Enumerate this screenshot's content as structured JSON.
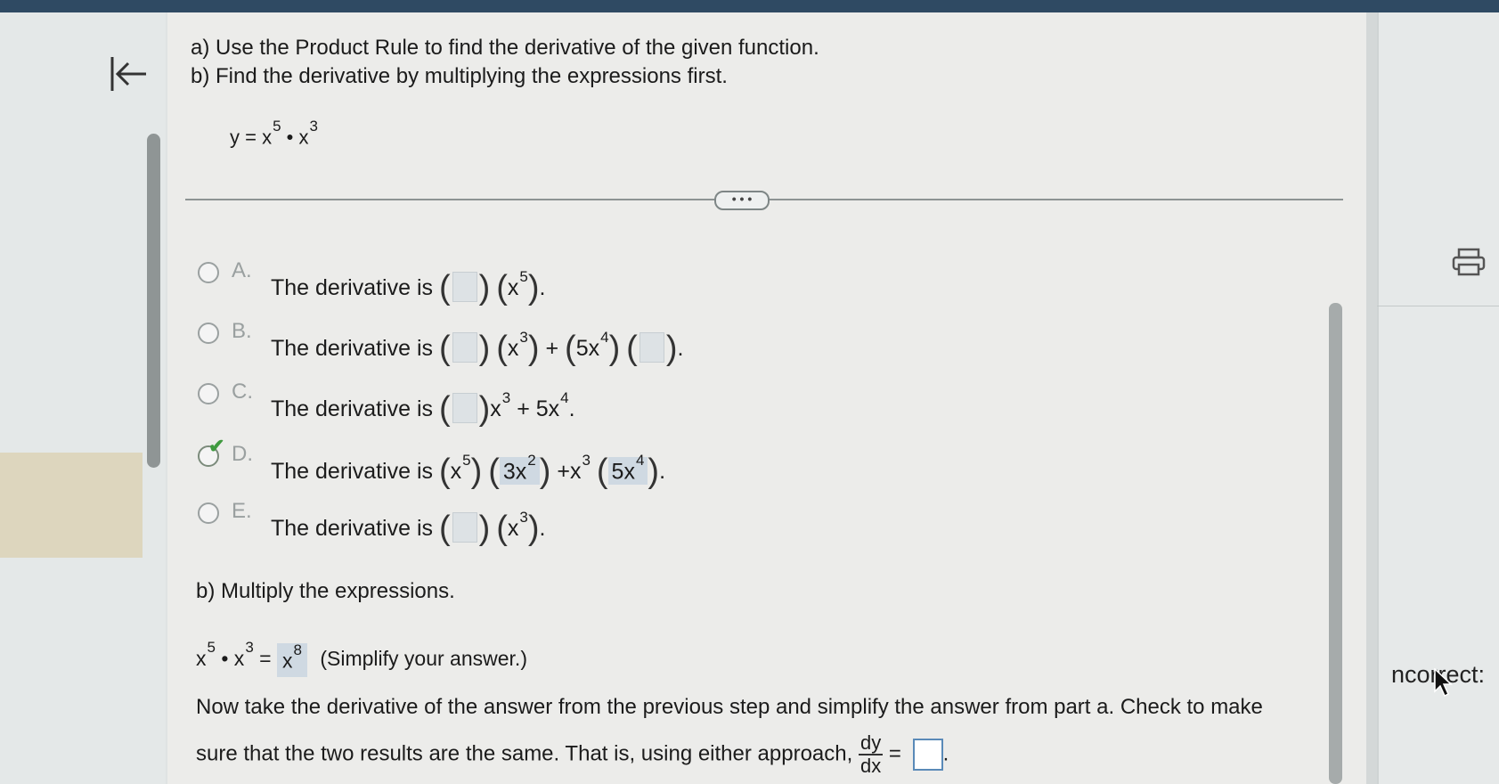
{
  "question": {
    "part_a": "a) Use the Product Rule to find the derivative of the given function.",
    "part_b": "b) Find the derivative by multiplying the expressions first."
  },
  "function": {
    "lhs": "y = x",
    "exp1": "5",
    "mid": " • x",
    "exp2": "3"
  },
  "more_button": "• • •",
  "options": [
    {
      "letter": "A.",
      "prefix": "The derivative is"
    },
    {
      "letter": "B.",
      "prefix": "The derivative is"
    },
    {
      "letter": "C.",
      "prefix": "The derivative is"
    },
    {
      "letter": "D.",
      "prefix": "The derivative is"
    },
    {
      "letter": "E.",
      "prefix": "The derivative is"
    }
  ],
  "selected_option": "D",
  "option_d": {
    "term1": "x",
    "term1_exp": "5",
    "ans1": "3x",
    "ans1_exp": "2",
    "plus": "+x",
    "plus_exp": "3",
    "ans2": "5x",
    "ans2_exp": "4"
  },
  "part_b_section": {
    "heading": "b) Multiply the expressions.",
    "product_lhs": "x",
    "lhs_exp1": "5",
    "lhs_mid": "• x",
    "lhs_exp2": "3",
    "equals": "=",
    "answer": "x",
    "answer_exp": "8",
    "hint": "(Simplify your answer.)",
    "instruction_line1": "Now take the derivative of the answer from the previous step and simplify the answer from part a. Check to make",
    "instruction_line2": "sure that the two results are the same. That is, using either approach,",
    "dy": "dy",
    "dx": "dx",
    "equals2": "="
  },
  "side_status": "ncorrect:",
  "colors": {
    "topbar": "#2f4a63",
    "answer_fill": "#cfd9e2",
    "check": "#3f9a3f"
  }
}
